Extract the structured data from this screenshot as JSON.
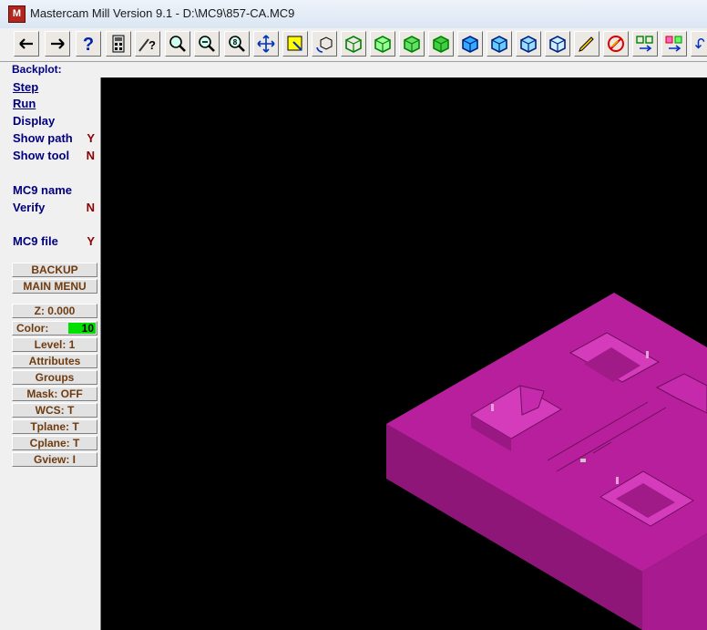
{
  "window": {
    "title": "Mastercam Mill Version 9.1 - D:\\MC9\\857-CA.MC9",
    "app_icon": "mastercam-icon"
  },
  "toolbar": {
    "buttons": [
      "back",
      "forward",
      "help",
      "calculator",
      "analyze",
      "zoom-window",
      "unzoom",
      "zoom-fit",
      "pan",
      "select-window",
      "rotate",
      "view-top",
      "view-front",
      "view-side",
      "view-iso",
      "view-top-solid",
      "view-front-solid",
      "view-side-solid",
      "view-iso-solid",
      "edit",
      "delete",
      "group",
      "color-group",
      "undo"
    ]
  },
  "prompt": "Backplot:",
  "menu": {
    "items": [
      {
        "label": "Step",
        "value": ""
      },
      {
        "label": "Run",
        "value": ""
      },
      {
        "label": "Display",
        "value": ""
      },
      {
        "label": "Show path",
        "value": "Y"
      },
      {
        "label": "Show tool",
        "value": "N"
      },
      {
        "label": "MC9 name",
        "value": ""
      },
      {
        "label": "Verify",
        "value": "N"
      },
      {
        "label": "MC9 file",
        "value": "Y"
      }
    ]
  },
  "buttons": {
    "backup": "BACKUP",
    "main_menu": "MAIN MENU",
    "z": "Z:   0.000",
    "color_label": "Color:",
    "color_value": "10",
    "level": "Level:  1",
    "attributes": "Attributes",
    "groups": "Groups",
    "mask": "Mask:  OFF",
    "wcs": "WCS:   T",
    "tplane": "Tplane:  T",
    "cplane": "Cplane:  T",
    "gview": "Gview:   I"
  },
  "colors": {
    "part": "#a51c8f",
    "part_top": "#c0209f",
    "background": "#000000",
    "menu_text": "#00007f",
    "button_text": "#6e3b10",
    "color_swatch": "#00e000"
  }
}
